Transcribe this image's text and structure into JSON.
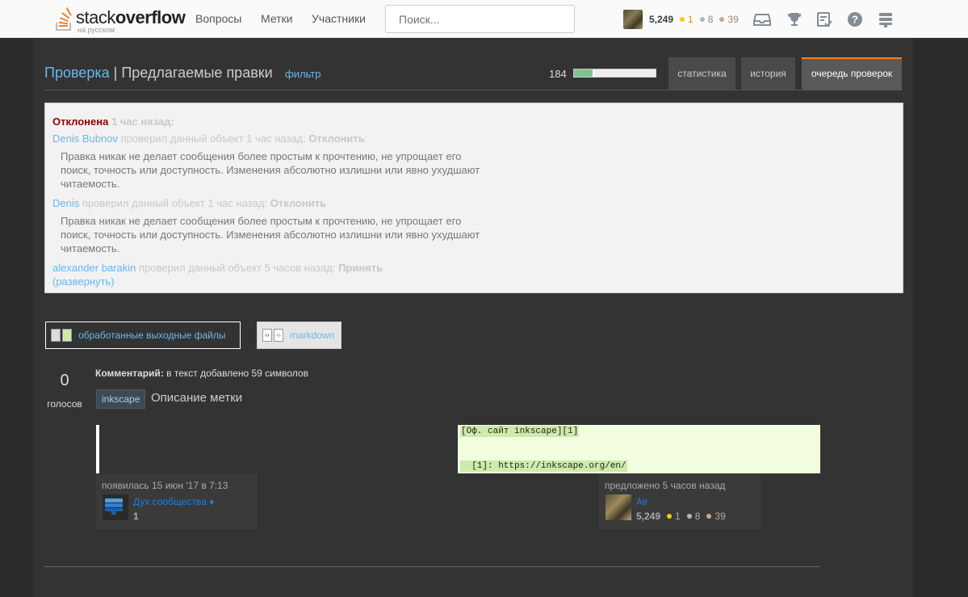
{
  "topbar": {
    "logo_word_light": "stack",
    "logo_word_bold": "overflow",
    "logo_sub": "на русском",
    "nav": [
      "Вопросы",
      "Метки",
      "Участники"
    ],
    "search_placeholder": "Поиск...",
    "user": {
      "rep": "5,249",
      "gold": "1",
      "silver": "8",
      "bronze": "39"
    },
    "icons": [
      "inbox-icon",
      "achievements-icon",
      "review-icon",
      "help-icon",
      "site-switcher-icon"
    ]
  },
  "header": {
    "title_link": "Проверка",
    "separator": "|",
    "title": "Предлагаемые правки",
    "filter": "фильтр",
    "count": "184",
    "progress_fraction": 0.25,
    "tabs": [
      "статистика",
      "история",
      "очередь проверок"
    ]
  },
  "review": {
    "status": "Отклонена",
    "status_time": "1 час назад:",
    "reviews": [
      {
        "user": "Denis Bubnov",
        "action": "проверил данный объект 1 час назад:",
        "verdict": "Отклонить",
        "reason": "Правка никак не делает сообщения более простым к прочтению, не упрощает его поиск, точность или доступность. Изменения абсолютно излишни или явно ухудшают читаемость."
      },
      {
        "user": "Denis",
        "action": "проверил данный объект 1 час назад:",
        "verdict": "Отклонить",
        "reason": "Правка никак не делает сообщения более простым к прочтению, не упрощает его поиск, точность или доступность. Изменения абсолютно излишни или явно ухудшают читаемость."
      },
      {
        "user": "alexander barakin",
        "action": "проверил данный объект 5 часов назад:",
        "verdict": "Принять"
      }
    ],
    "expand": "(развернуть)"
  },
  "switcher": {
    "output": "обработанные выходные файлы",
    "markdown": "markdown"
  },
  "edit": {
    "votes": "0",
    "votes_label": "голосов",
    "comment_label": "Комментарий:",
    "comment": "в текст добавлено 59 символов",
    "tag": "inkscape",
    "tag_title": "Описание метки",
    "diff_lines": [
      "[Оф. сайт inkscape][1]",
      "  [1]: https://inkscape.org/en/"
    ]
  },
  "signatures": {
    "original": {
      "time": "появилась 15 июн '17 в 7:13",
      "name": "Дух сообщества ♦",
      "rep": "1"
    },
    "proposed": {
      "time": "предложено 5 часов назад",
      "name": "Air",
      "rep": "5,249",
      "gold": "1",
      "silver": "8",
      "bronze": "39"
    }
  }
}
